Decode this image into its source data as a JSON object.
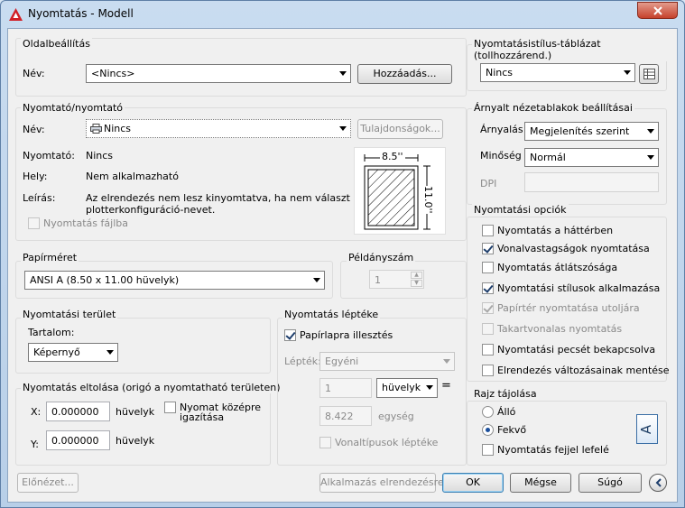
{
  "window": {
    "title": "Nyomtatás - Modell"
  },
  "page_setup": {
    "group": "Oldalbeállítás",
    "name_label": "Név:",
    "name_value": "<Nincs>",
    "add_button": "Hozzáadás..."
  },
  "printer": {
    "group": "Nyomtató/nyomtató",
    "name_label": "Név:",
    "name_value": "Nincs",
    "properties_button": "Tulajdonságok...",
    "plotter_label": "Nyomtató:",
    "plotter_value": "Nincs",
    "where_label": "Hely:",
    "where_value": "Nem alkalmazható",
    "desc_label": "Leírás:",
    "desc_line1": "Az elrendezés nem lesz kinyomtatva, ha nem választ új",
    "desc_line2": "plotterkonfiguráció-nevet.",
    "plot_to_file": "Nyomtatás fájlba",
    "preview_width": "8.5''",
    "preview_height": "11.0''"
  },
  "paper_size": {
    "group": "Papírméret",
    "value": "ANSI A (8.50 x 11.00 hüvelyk)"
  },
  "copies": {
    "group": "Példányszám",
    "value": "1"
  },
  "plot_area": {
    "group": "Nyomtatási terület",
    "what_label": "Tartalom:",
    "what_value": "Képernyő"
  },
  "plot_offset": {
    "group": "Nyomtatás eltolása (origó a nyomtatható területen)",
    "x_label": "X:",
    "x_value": "0.000000",
    "x_unit": "hüvelyk",
    "y_label": "Y:",
    "y_value": "0.000000",
    "y_unit": "hüvelyk",
    "center_line1": "Nyomat középre",
    "center_line2": "igazítása"
  },
  "plot_scale": {
    "group": "Nyomtatás léptéke",
    "fit": "Papírlapra illesztés",
    "scale_label": "Lépték:",
    "scale_value": "Egyéni",
    "inches_value": "1",
    "unit_value": "hüvelyk",
    "equals": "=",
    "units_value": "8.422",
    "units_label": "egység",
    "lineweights": "Vonaltípusok léptéke"
  },
  "plot_style": {
    "group": "Nyomtatásistílus-táblázat (tollhozzárend.)",
    "value": "Nincs"
  },
  "shaded": {
    "group": "Árnyalt nézetablakok beállításai",
    "shade_label": "Árnyalás",
    "shade_value": "Megjelenítés szerint",
    "quality_label": "Minőség",
    "quality_value": "Normál",
    "dpi_label": "DPI"
  },
  "options": {
    "group": "Nyomtatási opciók",
    "items": [
      {
        "label": "Nyomtatás a háttérben",
        "checked": false,
        "enabled": true
      },
      {
        "label": "Vonalvastagságok nyomtatása",
        "checked": true,
        "enabled": true
      },
      {
        "label": "Nyomtatás átlátszósága",
        "checked": false,
        "enabled": true
      },
      {
        "label": "Nyomtatási stílusok alkalmazása",
        "checked": true,
        "enabled": true
      },
      {
        "label": "Papírtér nyomtatása utoljára",
        "checked": true,
        "enabled": false
      },
      {
        "label": "Takartvonalas nyomtatás",
        "checked": false,
        "enabled": false
      },
      {
        "label": "Nyomtatási pecsét bekapcsolva",
        "checked": false,
        "enabled": true
      },
      {
        "label": "Elrendezés változásainak mentése",
        "checked": false,
        "enabled": true
      }
    ]
  },
  "orientation": {
    "group": "Rajz tájolása",
    "portrait": "Álló",
    "landscape": "Fekvő",
    "upside_down": "Nyomtatás fejjel lefelé",
    "icon_letter": "A"
  },
  "footer": {
    "preview": "Előnézet...",
    "apply": "Alkalmazás elrendezésre",
    "ok": "OK",
    "cancel": "Mégse",
    "help": "Súgó"
  }
}
